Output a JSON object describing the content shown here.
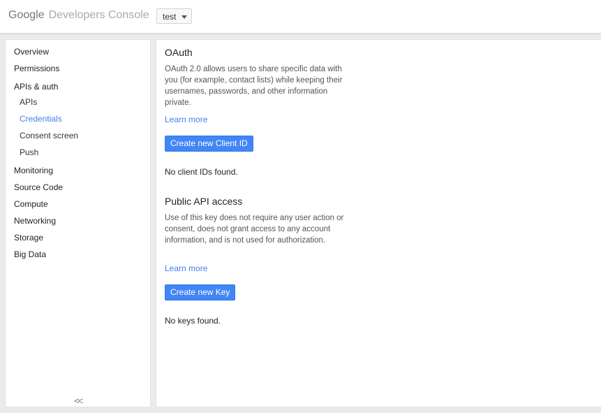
{
  "header": {
    "brand_google": "Google",
    "brand_console": "Developers Console",
    "project": "test"
  },
  "sidebar": {
    "items": [
      {
        "label": "Overview"
      },
      {
        "label": "Permissions"
      },
      {
        "label": "APIs & auth"
      },
      {
        "label": "APIs"
      },
      {
        "label": "Credentials"
      },
      {
        "label": "Consent screen"
      },
      {
        "label": "Push"
      },
      {
        "label": "Monitoring"
      },
      {
        "label": "Source Code"
      },
      {
        "label": "Compute"
      },
      {
        "label": "Networking"
      },
      {
        "label": "Storage"
      },
      {
        "label": "Big Data"
      }
    ],
    "collapse_label": "<<"
  },
  "main": {
    "oauth": {
      "title": "OAuth",
      "description": "OAuth 2.0 allows users to share specific data with you (for example, contact lists) while keeping their usernames, passwords, and other information private.",
      "learn_more": "Learn more",
      "button": "Create new Client ID",
      "status": "No client IDs found."
    },
    "public_api": {
      "title": "Public API access",
      "description": "Use of this key does not require any user action or consent, does not grant access to any account information, and is not used for authorization.",
      "learn_more": "Learn more",
      "button": "Create new Key",
      "status": "No keys found."
    }
  },
  "colors": {
    "accent": "#427fed",
    "button_bg": "#4285f4",
    "page_bg": "#ebebeb"
  }
}
